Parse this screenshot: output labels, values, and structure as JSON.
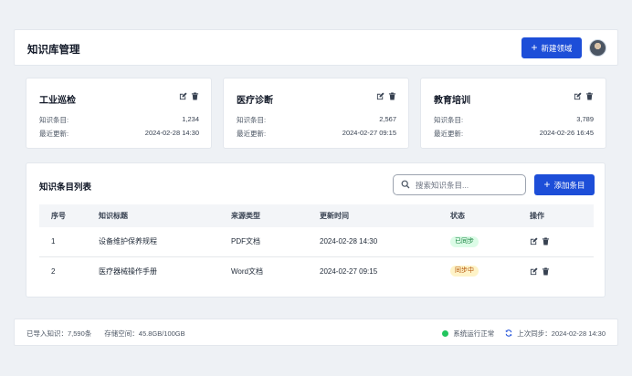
{
  "header": {
    "title": "知识库管理",
    "new_domain_label": "新建领域"
  },
  "domains": [
    {
      "title": "工业巡检",
      "items_label": "知识条目:",
      "items_value": "1,234",
      "updated_label": "最近更新:",
      "updated_value": "2024-02-28 14:30"
    },
    {
      "title": "医疗诊断",
      "items_label": "知识条目:",
      "items_value": "2,567",
      "updated_label": "最近更新:",
      "updated_value": "2024-02-27 09:15"
    },
    {
      "title": "教育培训",
      "items_label": "知识条目:",
      "items_value": "3,789",
      "updated_label": "最近更新:",
      "updated_value": "2024-02-26 16:45"
    }
  ],
  "list": {
    "title": "知识条目列表",
    "search_placeholder": "搜索知识条目...",
    "add_label": "添加条目",
    "columns": [
      "序号",
      "知识标题",
      "来源类型",
      "更新时间",
      "状态",
      "操作"
    ],
    "rows": [
      {
        "no": "1",
        "title": "设备维护保养规程",
        "source": "PDF文档",
        "time": "2024-02-28 14:30",
        "status": "已同步"
      },
      {
        "no": "2",
        "title": "医疗器械操作手册",
        "source": "Word文档",
        "time": "2024-02-27 09:15",
        "status": "同步中"
      }
    ]
  },
  "footer": {
    "imported": "已导入知识：7,590条",
    "storage": "存储空间：45.8GB/100GB",
    "system_status": "系统运行正常",
    "last_sync": "上次同步：2024-02-28 14:30"
  },
  "colors": {
    "accent": "#1d4ed8",
    "status_ok": "#22c55e",
    "synced_bg": "#dcfce7",
    "syncing_bg": "#fef3c7"
  },
  "icons": [
    "plus-icon",
    "edit-icon",
    "trash-icon",
    "search-icon",
    "sync-icon",
    "avatar"
  ]
}
